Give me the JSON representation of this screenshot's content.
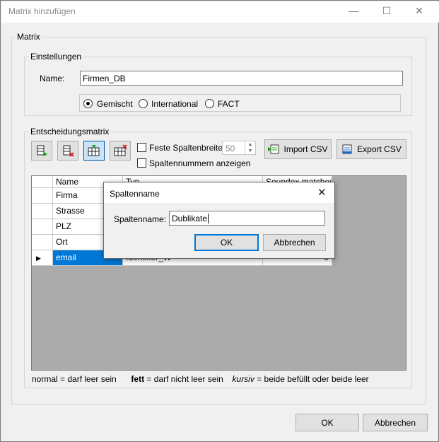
{
  "window": {
    "title": "Matrix hinzufügen",
    "minimize": "—",
    "maximize": "☐",
    "close": "✕"
  },
  "matrix_group": {
    "legend": "Matrix"
  },
  "settings": {
    "legend": "Einstellungen",
    "name_label": "Name:",
    "name_value": "Firmen_DB",
    "radios": [
      {
        "label": "Gemischt",
        "selected": true
      },
      {
        "label": "International",
        "selected": false
      },
      {
        "label": "FACT",
        "selected": false
      }
    ]
  },
  "decision": {
    "legend": "Entscheidungsmatrix",
    "toolbar_icons": [
      "add-column-icon",
      "delete-column-icon",
      "add-row-icon",
      "delete-row-icon"
    ],
    "fixed_width_label": "Feste Spaltenbreite",
    "fixed_width_value": "50",
    "show_numbers_label": "Spaltennummern anzeigen",
    "import_label": "Import CSV",
    "export_label": "Export CSV"
  },
  "grid": {
    "headers": [
      "Name",
      "Typ",
      "Soundex matches"
    ],
    "rows": [
      {
        "name": "Firma",
        "typ": "",
        "value": ""
      },
      {
        "name": "Strasse",
        "typ": "",
        "value": ""
      },
      {
        "name": "PLZ",
        "typ": "",
        "value": ""
      },
      {
        "name": "Ort",
        "typ": "",
        "value": ""
      },
      {
        "name": "email",
        "typ": "Identifier_W",
        "value": "0",
        "selected": true,
        "current_marker": "▶"
      }
    ]
  },
  "legend_text": {
    "normal": "normal = darf leer sein",
    "fett_bold": "fett",
    "fett_rest": " = darf nicht leer sein",
    "kursiv_italic": "kursiv",
    "kursiv_rest": " = beide befüllt oder beide leer"
  },
  "footer": {
    "ok": "OK",
    "cancel": "Abbrechen"
  },
  "dialog": {
    "title": "Spaltenname",
    "close": "✕",
    "label": "Spaltenname:",
    "value": "Dublikate",
    "ok": "OK",
    "cancel": "Abbrechen"
  },
  "colors": {
    "accent": "#0078d7",
    "selection": "#0078d7",
    "grid_bg": "#ababab",
    "window_bg": "#f0f0f0"
  }
}
